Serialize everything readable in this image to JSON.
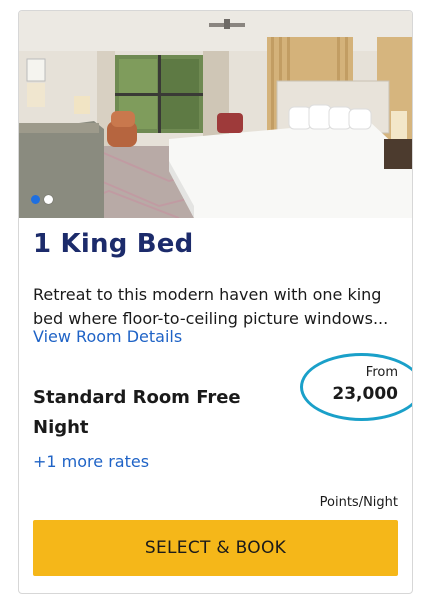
{
  "room": {
    "title": "1 King Bed",
    "description": "Retreat to this modern haven with one king bed where floor-to-ceiling picture windows...",
    "view_details_label": "View Room Details"
  },
  "rate": {
    "name": "Standard Room Free Night",
    "more_rates_label": "+1 more rates",
    "from_label": "From",
    "points": "23,000",
    "unit_label": "Points/Night"
  },
  "actions": {
    "book_label": "SELECT & BOOK"
  },
  "carousel": {
    "slide_count": 2,
    "active_index": 0
  },
  "colors": {
    "title": "#1c2b6b",
    "link": "#1f63c6",
    "book_button": "#f5b719",
    "highlight_circle": "#1aa0c9"
  }
}
